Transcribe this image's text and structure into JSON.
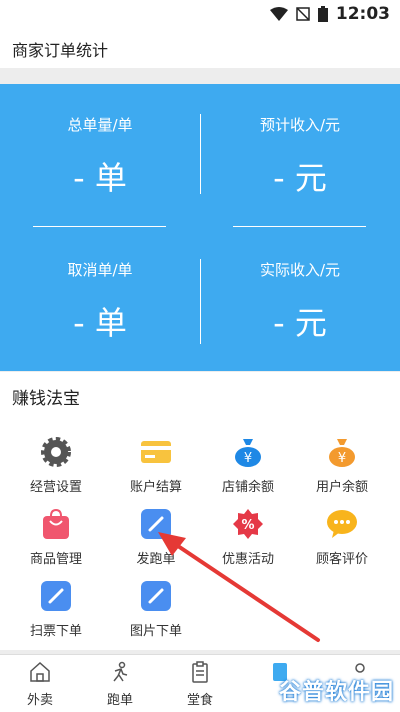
{
  "status": {
    "time": "12:03"
  },
  "header": {
    "title": "商家订单统计"
  },
  "stats": {
    "total_orders_label": "总单量/单",
    "total_orders_value": "- 单",
    "expected_income_label": "预计收入/元",
    "expected_income_value": "- 元",
    "cancelled_label": "取消单/单",
    "cancelled_value": "- 单",
    "actual_income_label": "实际收入/元",
    "actual_income_value": "- 元"
  },
  "section": {
    "title": "赚钱法宝"
  },
  "tools": [
    {
      "label": "经营设置",
      "icon": "gear-icon"
    },
    {
      "label": "账户结算",
      "icon": "card-icon"
    },
    {
      "label": "店铺余额",
      "icon": "money-bag-icon"
    },
    {
      "label": "用户余额",
      "icon": "money-bag-icon"
    },
    {
      "label": "商品管理",
      "icon": "shopping-bag-icon"
    },
    {
      "label": "发跑单",
      "icon": "pencil-icon"
    },
    {
      "label": "优惠活动",
      "icon": "discount-icon"
    },
    {
      "label": "顾客评价",
      "icon": "chat-icon"
    },
    {
      "label": "扫票下单",
      "icon": "pencil-icon"
    },
    {
      "label": "图片下单",
      "icon": "pencil-icon"
    }
  ],
  "tabs": [
    {
      "label": "外卖"
    },
    {
      "label": "跑单"
    },
    {
      "label": "堂食"
    }
  ],
  "watermark": "谷普软件园",
  "colors": {
    "stats_bg": "#3eaaf0",
    "accent_red": "#e53935"
  }
}
